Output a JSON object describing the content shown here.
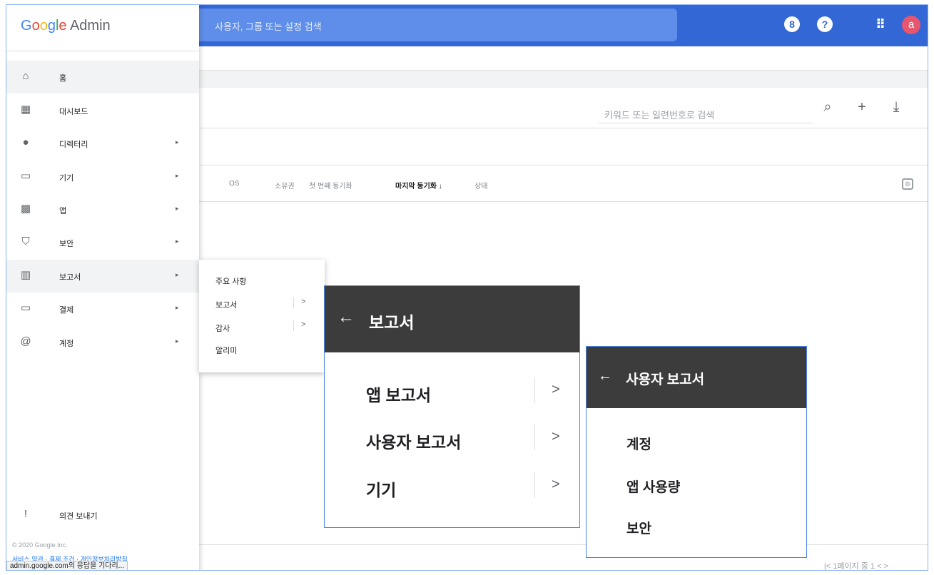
{
  "topbar": {
    "search_placeholder": "사용자, 그룹 또는 설정 검색",
    "icon_8": "8",
    "icon_help": "?",
    "icon_apps": "⠿",
    "avatar": "a"
  },
  "drawer": {
    "logo_g": [
      "G",
      "o",
      "o",
      "g",
      "l",
      "e"
    ],
    "logo_suffix": " Admin",
    "items": [
      {
        "label": "홈",
        "icon": "home-icon",
        "glyph": "⌂",
        "arrow": false
      },
      {
        "label": "대시보드",
        "icon": "dashboard-icon",
        "glyph": "▦",
        "arrow": false
      },
      {
        "label": "디렉터리",
        "icon": "person-icon",
        "glyph": "●",
        "arrow": true
      },
      {
        "label": "기기",
        "icon": "devices-icon",
        "glyph": "▭",
        "arrow": true
      },
      {
        "label": "앱",
        "icon": "apps-grid-icon",
        "glyph": "▩",
        "arrow": true
      },
      {
        "label": "보안",
        "icon": "shield-icon",
        "glyph": "⛉",
        "arrow": true
      },
      {
        "label": "보고서",
        "icon": "reports-icon",
        "glyph": "▥",
        "arrow": true
      },
      {
        "label": "결제",
        "icon": "billing-icon",
        "glyph": "▭",
        "arrow": true
      },
      {
        "label": "계정",
        "icon": "at-icon",
        "glyph": "@",
        "arrow": true
      }
    ],
    "arrow_glyph": "▸",
    "feedback": {
      "label": "의견 보내기",
      "glyph": "!"
    },
    "copyright": "© 2020 Google Inc.",
    "legal": "서비스 약관 · 결제 조건 · 개인정보처리방침",
    "status": "admin.google.com의 응답을 기다리..."
  },
  "card": {
    "keyword_placeholder": "키워드 또는 일련번호로 검색",
    "search_glyph": "⌕",
    "add_glyph": "+",
    "download_glyph": "⤓",
    "columns": [
      "OS",
      "소유권",
      "첫 번째 동기화",
      "마지막 동기화 ↓",
      "상태"
    ],
    "gear_glyph": "⚙",
    "pager": "|<   1페이지 중 1    <        >"
  },
  "flyout": {
    "items": [
      "주요 사항",
      "보고서",
      "감사",
      "알리미"
    ],
    "chevron": ">"
  },
  "panel_reports": {
    "back": "←",
    "title": "보고서",
    "items": [
      "앱 보고서",
      "사용자 보고서",
      "기기"
    ],
    "chevron": ">"
  },
  "panel_user_reports": {
    "back": "←",
    "title": "사용자 보고서",
    "items": [
      "계정",
      "앱 사용량",
      "보안"
    ]
  },
  "colors": {
    "topbar": "#3367d6",
    "panel_header": "#3c3c3c",
    "highlight_border": "#4a86e8"
  }
}
